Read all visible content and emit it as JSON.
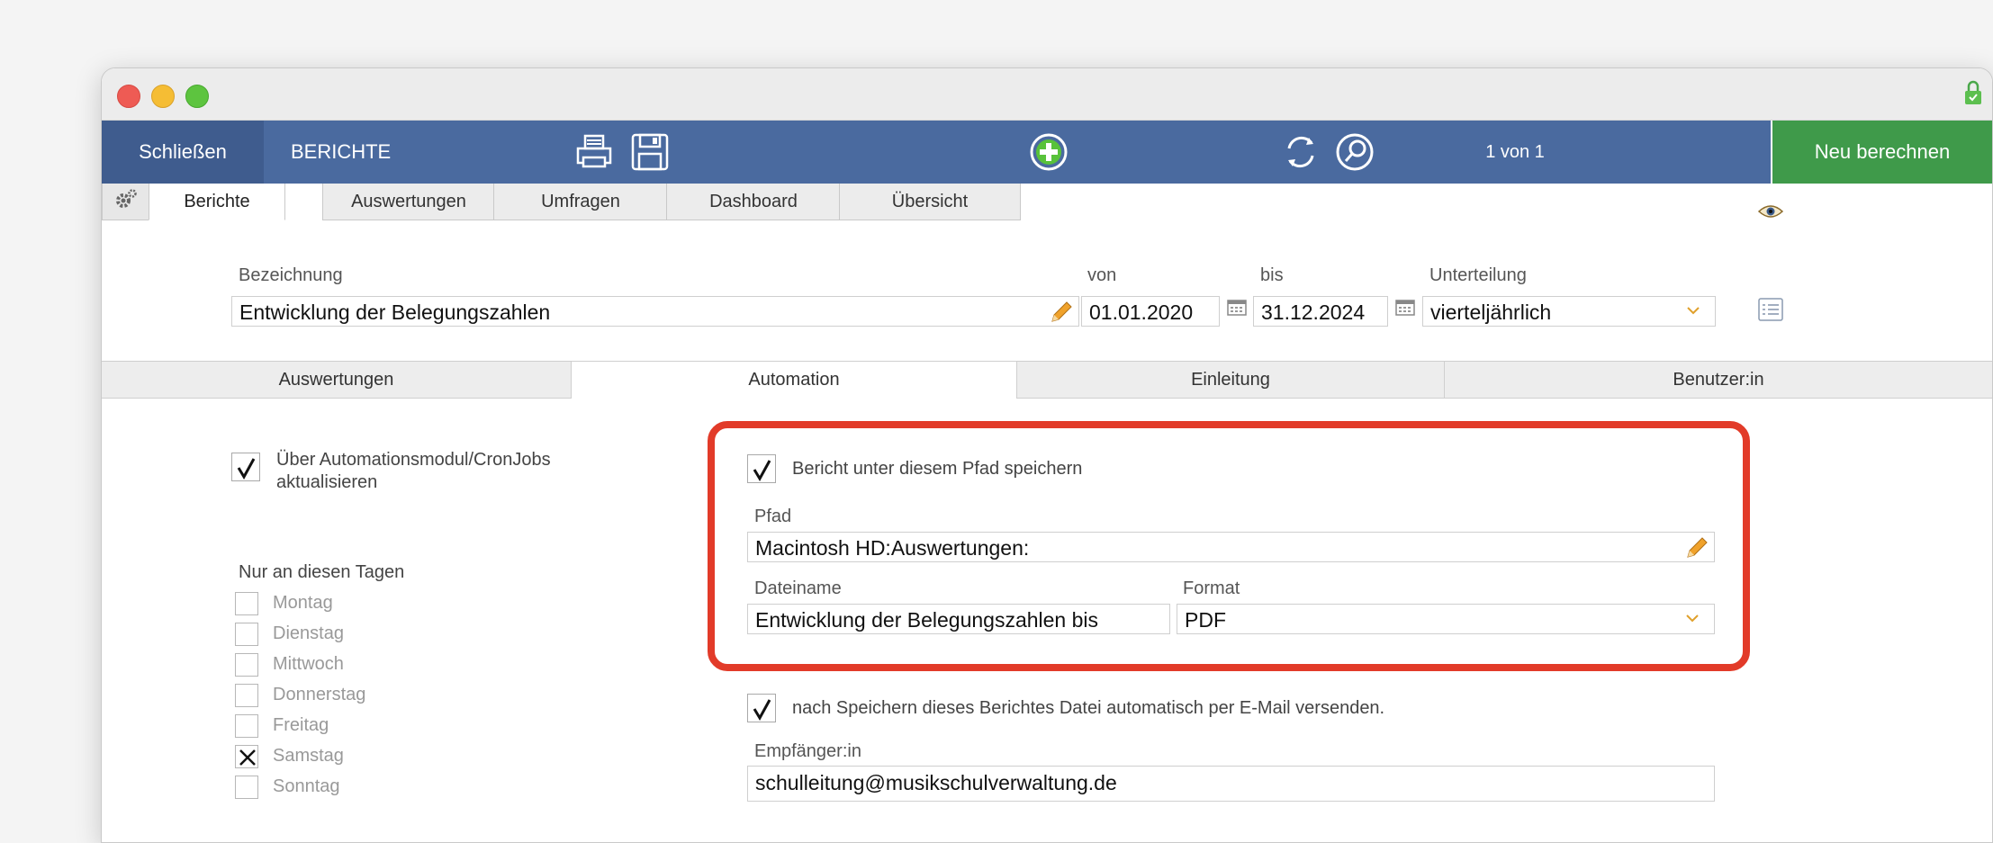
{
  "toolbar": {
    "close_label": "Schließen",
    "title": "BERICHTE",
    "record_counter": "1 von 1",
    "recalc_label": "Neu berechnen"
  },
  "tabs": [
    "Berichte",
    "Auswertungen",
    "Umfragen",
    "Dashboard",
    "Übersicht"
  ],
  "form": {
    "bezeichnung_label": "Bezeichnung",
    "bezeichnung_value": "Entwicklung der Belegungszahlen",
    "von_label": "von",
    "von_value": "01.01.2020",
    "bis_label": "bis",
    "bis_value": "31.12.2024",
    "unterteilung_label": "Unterteilung",
    "unterteilung_value": "vierteljährlich"
  },
  "subtabs": [
    "Auswertungen",
    "Automation",
    "Einleitung",
    "Benutzer:in"
  ],
  "automation": {
    "cron_label": "Über Automationsmodul/CronJobs aktualisieren",
    "cron_checked": true,
    "days_label": "Nur an diesen Tagen",
    "days": [
      {
        "name": "Montag",
        "checked": false
      },
      {
        "name": "Dienstag",
        "checked": false
      },
      {
        "name": "Mittwoch",
        "checked": false
      },
      {
        "name": "Donnerstag",
        "checked": false
      },
      {
        "name": "Freitag",
        "checked": false
      },
      {
        "name": "Samstag",
        "checked": true
      },
      {
        "name": "Sonntag",
        "checked": false
      }
    ],
    "save_path_label": "Bericht unter diesem Pfad speichern",
    "save_path_checked": true,
    "pfad_label": "Pfad",
    "pfad_value": "Macintosh HD:Auswertungen:",
    "dateiname_label": "Dateiname",
    "dateiname_value": "Entwicklung der Belegungszahlen bis",
    "format_label": "Format",
    "format_value": "PDF",
    "email_label": "nach Speichern dieses Berichtes Datei automatisch per E-Mail versenden.",
    "email_checked": true,
    "empfaenger_label": "Empfänger:in",
    "empfaenger_value": "schulleitung@musikschulverwaltung.de"
  },
  "colors": {
    "toolbar": "#4a6a9f",
    "recalc": "#3f9a4a",
    "highlight": "#e23b29",
    "add_icon": "#58c23a",
    "pencil": "#f0a22b"
  },
  "icons": [
    "printer-icon",
    "save-icon",
    "add-icon",
    "refresh-icon",
    "search-icon",
    "gear-icon",
    "eye-icon",
    "calendar-icon",
    "pencil-icon",
    "chevron-down-icon",
    "list-icon",
    "lock-icon"
  ]
}
